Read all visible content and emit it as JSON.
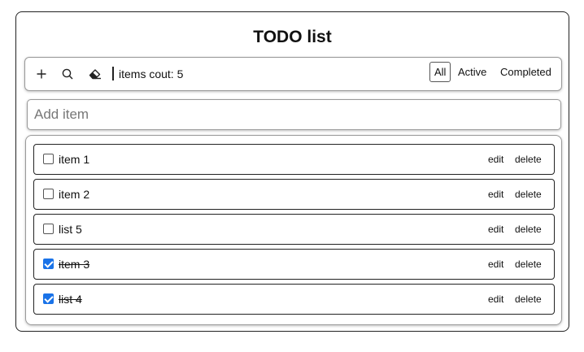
{
  "app": {
    "title": "TODO list"
  },
  "toolbar": {
    "add_icon": "plus-icon",
    "search_icon": "search-icon",
    "clear_icon": "eraser-icon",
    "count_label": "items cout: 5",
    "filters": [
      "All",
      "Active",
      "Completed"
    ],
    "active_filter": "All"
  },
  "add_item": {
    "placeholder": "Add item"
  },
  "items": [
    {
      "label": "item 1",
      "completed": false,
      "edit_label": "edit",
      "delete_label": "delete"
    },
    {
      "label": "item 2",
      "completed": false,
      "edit_label": "edit",
      "delete_label": "delete"
    },
    {
      "label": "list 5",
      "completed": false,
      "edit_label": "edit",
      "delete_label": "delete"
    },
    {
      "label": "item 3",
      "completed": true,
      "edit_label": "edit",
      "delete_label": "delete"
    },
    {
      "label": "list 4",
      "completed": true,
      "edit_label": "edit",
      "delete_label": "delete"
    }
  ],
  "colors": {
    "checkbox_checked": "#1a73e8",
    "border": "#222222"
  }
}
